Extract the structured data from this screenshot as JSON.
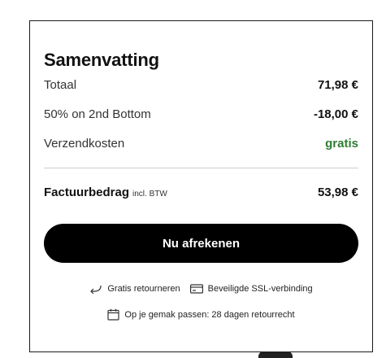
{
  "summary": {
    "title": "Samenvatting",
    "rows": [
      {
        "label": "Totaal",
        "value": "71,98 €"
      },
      {
        "label": "50% on 2nd Bottom",
        "value": "-18,00 €"
      },
      {
        "label": "Verzendkosten",
        "value": "gratis"
      }
    ],
    "total": {
      "label": "Factuurbedrag",
      "note": "incl. BTW",
      "value": "53,98 €"
    },
    "checkout_label": "Nu afrekenen",
    "features": [
      {
        "icon": "return-arrow-icon",
        "label": "Gratis retourneren"
      },
      {
        "icon": "card-icon",
        "label": "Beveiligde SSL-verbinding"
      },
      {
        "icon": "calendar-icon",
        "label": "Op je gemak passen: 28 dagen retourrecht"
      }
    ]
  },
  "colors": {
    "accent_green": "#2e7d32",
    "button_bg": "#000000"
  }
}
